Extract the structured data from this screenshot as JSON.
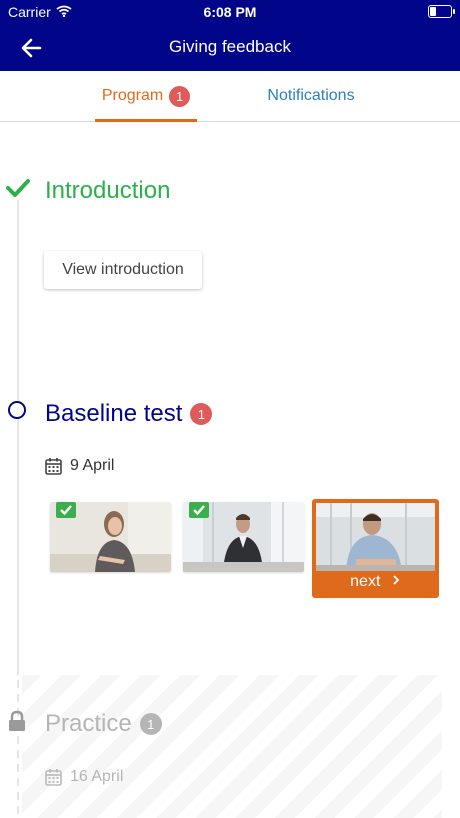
{
  "status_bar": {
    "carrier": "Carrier",
    "time": "6:08 PM"
  },
  "nav": {
    "title": "Giving feedback"
  },
  "tabs": [
    {
      "label": "Program",
      "badge": "1"
    },
    {
      "label": "Notifications"
    }
  ],
  "timeline": {
    "introduction": {
      "title": "Introduction",
      "button": "View introduction"
    },
    "baseline": {
      "title": "Baseline test",
      "badge": "1",
      "date": "9 April",
      "videos": [
        {
          "completed": true
        },
        {
          "completed": true
        },
        {
          "next_label": "next"
        }
      ]
    },
    "practice": {
      "title": "Practice",
      "badge": "1",
      "date": "16 April"
    }
  },
  "colors": {
    "brand": "#01058a",
    "accent": "#e06a1b",
    "success": "#2bb14a",
    "link": "#2a7fc4",
    "badge": "#e05a5a"
  },
  "icons": [
    "wifi-icon",
    "battery-icon",
    "back-arrow-icon",
    "check-icon",
    "circle-icon",
    "calendar-icon",
    "lock-icon",
    "chevron-right-icon"
  ]
}
